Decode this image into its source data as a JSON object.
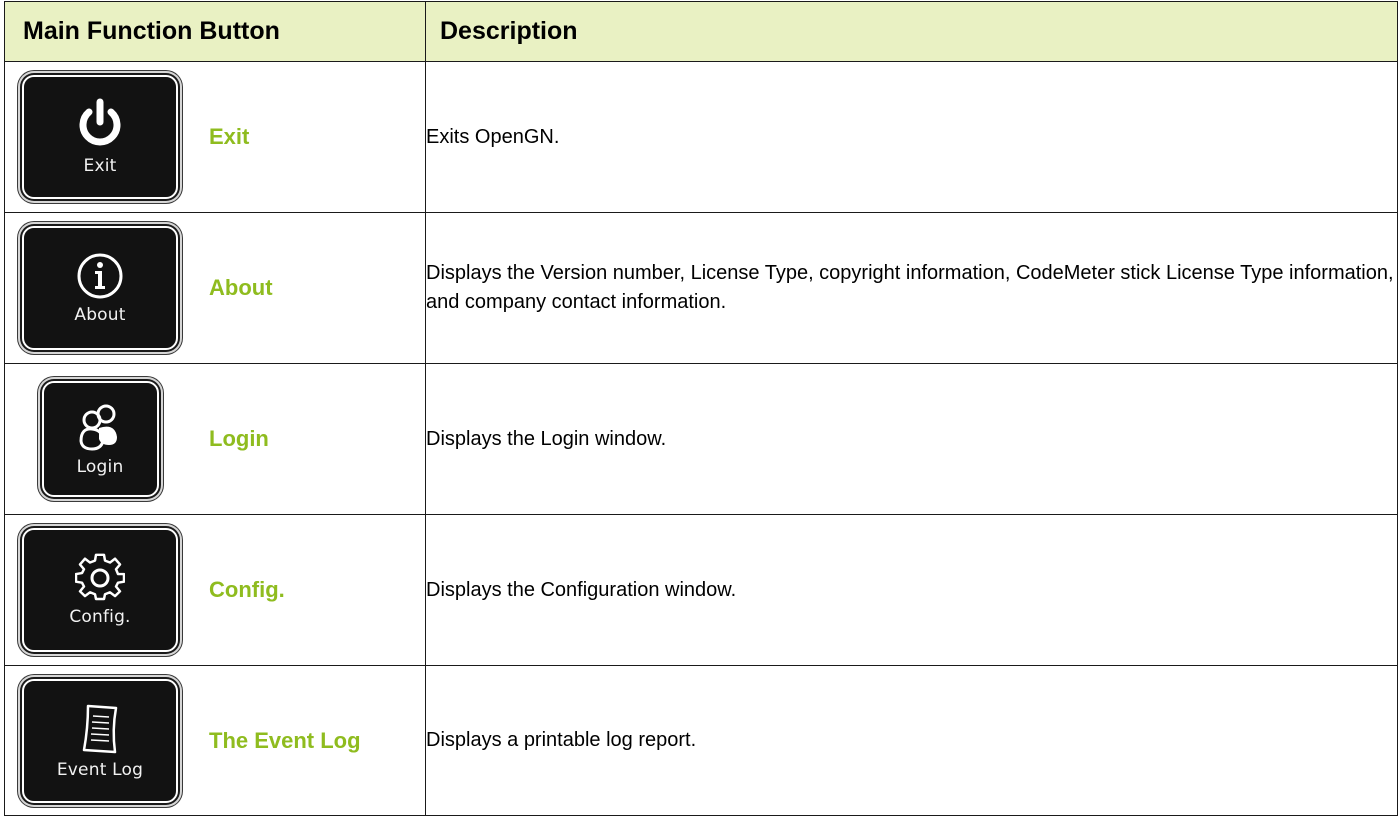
{
  "header": {
    "col1": "Main Function Button",
    "col2": "Description"
  },
  "colors": {
    "header_bg": "#e9f1c3",
    "button_name": "#8fbc1f",
    "icon_bg": "#121212"
  },
  "rows": [
    {
      "icon": "power-icon",
      "caption": "Exit",
      "name": "Exit",
      "description": "Exits OpenGN."
    },
    {
      "icon": "info-icon",
      "caption": "About",
      "name": "About",
      "description": "Displays the Version number, License Type, copyright information, CodeMeter stick License Type information, and company contact information."
    },
    {
      "icon": "users-icon",
      "caption": "Login",
      "name": "Login",
      "description": "Displays the Login window."
    },
    {
      "icon": "gear-icon",
      "caption": "Config.",
      "name": "Config.",
      "description": "Displays the Configuration window."
    },
    {
      "icon": "document-icon",
      "caption": "Event Log",
      "name": "The Event Log",
      "description": "Displays a printable log report."
    }
  ]
}
